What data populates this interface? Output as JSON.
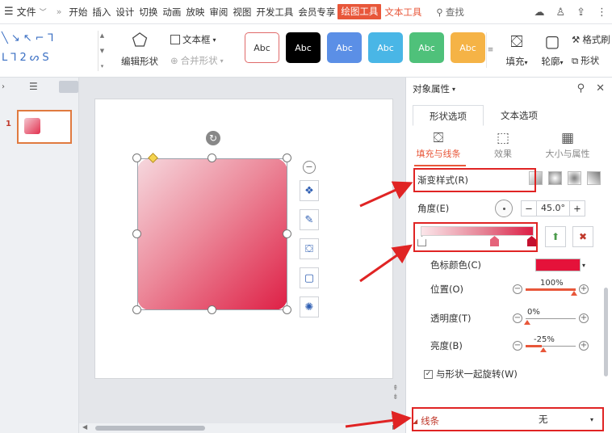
{
  "menubar": {
    "file_label": "文件",
    "items": [
      "开始",
      "插入",
      "设计",
      "切换",
      "动画",
      "放映",
      "审阅",
      "视图",
      "开发工具",
      "会员专享"
    ],
    "active_tab": "绘图工具",
    "context_tab": "文本工具",
    "search_label": "查找"
  },
  "ribbon": {
    "edit_shape": "编辑形状",
    "textbox": "文本框",
    "merge_shape": "合并形状",
    "style_boxes": [
      {
        "label": "Abc",
        "bg": "#ffffff",
        "fg": "#333333",
        "border": "#e06a6a"
      },
      {
        "label": "Abc",
        "bg": "#000000",
        "fg": "#ffffff",
        "border": "#000000"
      },
      {
        "label": "Abc",
        "bg": "#5b8fe6",
        "fg": "#ffffff",
        "border": "#5b8fe6"
      },
      {
        "label": "Abc",
        "bg": "#49b6e6",
        "fg": "#ffffff",
        "border": "#49b6e6"
      },
      {
        "label": "Abc",
        "bg": "#4fc17a",
        "fg": "#ffffff",
        "border": "#4fc17a"
      },
      {
        "label": "Abc",
        "bg": "#f5b346",
        "fg": "#ffffff",
        "border": "#f5b346"
      }
    ],
    "fill": "填充",
    "outline": "轮廓",
    "format_painter": "格式刷",
    "shape_effect": "形状"
  },
  "thumbs": {
    "slide_number": "1"
  },
  "props": {
    "panel_title": "对象属性",
    "tab_shape": "形状选项",
    "tab_text": "文本选项",
    "sub_fill_line": "填充与线条",
    "sub_effect": "效果",
    "sub_size": "大小与属性",
    "gradient_style": "渐变样式(R)",
    "angle_label": "角度(E)",
    "angle_value": "45.0°",
    "stop_color_label": "色标颜色(C)",
    "stop_color": "#e5123a",
    "position_label": "位置(O)",
    "position_value": "100%",
    "transparency_label": "透明度(T)",
    "transparency_value": "0%",
    "brightness_label": "亮度(B)",
    "brightness_value": "-25%",
    "rotate_with_shape": "与形状一起旋转(W)",
    "line_label": "线条",
    "line_value": "无"
  }
}
